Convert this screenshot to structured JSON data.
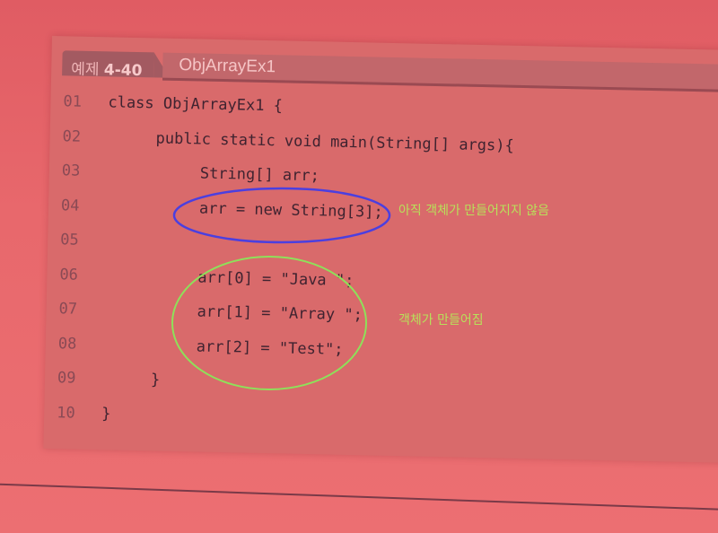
{
  "header": {
    "example_prefix": "예제",
    "example_number": "4-40",
    "title": "ObjArrayEx1"
  },
  "code_lines": [
    {
      "num": "01",
      "text": "class ObjArrayEx1 {",
      "indent": 0
    },
    {
      "num": "02",
      "text": "public static void main(String[] args){",
      "indent": 1
    },
    {
      "num": "03",
      "text": "String[] arr;",
      "indent": 2
    },
    {
      "num": "04",
      "text": "arr = new String[3];",
      "indent": 2
    },
    {
      "num": "05",
      "text": "",
      "indent": 0
    },
    {
      "num": "06",
      "text": "arr[0] = \"Java \";",
      "indent": 2
    },
    {
      "num": "07",
      "text": "arr[1] = \"Array \";",
      "indent": 2
    },
    {
      "num": "08",
      "text": "arr[2] = \"Test\";",
      "indent": 2
    },
    {
      "num": "09",
      "text": "}",
      "indent": 1
    },
    {
      "num": "10",
      "text": "}",
      "indent": 0
    }
  ],
  "annotations": {
    "note_1": "아직 객체가 만들어지지 않음",
    "note_2": "객체가 만들어짐"
  },
  "colors": {
    "note_text": "#b8e05a",
    "ellipse_blue": "#4b3fe0",
    "ellipse_green": "#8ee05a"
  }
}
